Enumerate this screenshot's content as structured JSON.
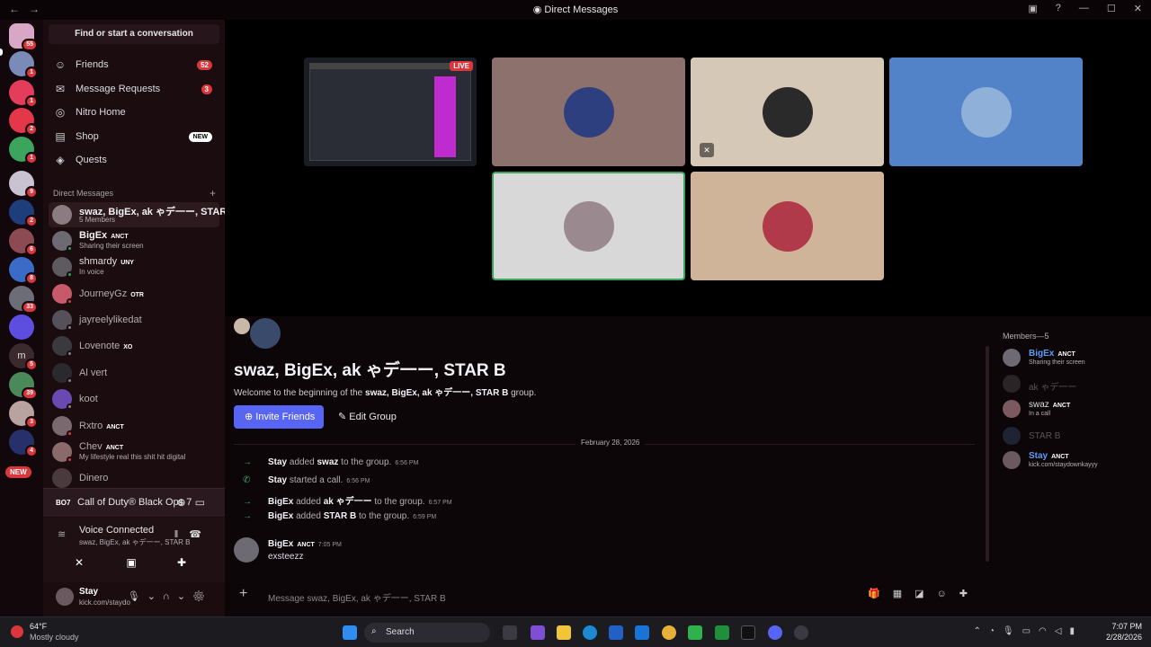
{
  "window": {
    "title": "Direct Messages"
  },
  "servers": [
    {
      "badge": "55"
    },
    {
      "badge": "1"
    },
    {
      "badge": "1"
    },
    {
      "badge": "2"
    },
    {
      "badge": "1"
    },
    {
      "badge": "9"
    },
    {
      "badge": "2"
    },
    {
      "badge": "6"
    },
    {
      "badge": "8"
    },
    {
      "badge": "33"
    },
    {
      "badge": ""
    },
    {
      "badge": "5"
    },
    {
      "badge": "39"
    },
    {
      "badge": "3"
    },
    {
      "badge": "4"
    }
  ],
  "rail_new": "NEW",
  "sidebar": {
    "find_label": "Find or start a conversation",
    "nav": [
      {
        "label": "Friends",
        "count": "52"
      },
      {
        "label": "Message Requests",
        "count": "3"
      },
      {
        "label": "Nitro Home",
        "count": ""
      },
      {
        "label": "Shop",
        "tag": "NEW"
      },
      {
        "label": "Quests",
        "count": ""
      }
    ],
    "dm_header": "Direct Messages",
    "dms": [
      {
        "name": "swaz, BigEx, ak ゃデ一ー, STAR B",
        "sub": "5 Members",
        "active": true,
        "bold": true
      },
      {
        "name": "BigEx",
        "tag": "ANCT",
        "sub": "Sharing their screen",
        "bold": true
      },
      {
        "name": "shmardy",
        "tag": "UNY",
        "sub": "In voice"
      },
      {
        "name": "JourneyGz",
        "tag": "OTR",
        "sub": ""
      },
      {
        "name": "jayreelylikedat",
        "sub": ""
      },
      {
        "name": "Lovenote",
        "tag": "XO",
        "sub": ""
      },
      {
        "name": "Al vert",
        "sub": ""
      },
      {
        "name": "koot",
        "sub": ""
      },
      {
        "name": "Rxtro",
        "tag": "ANCT",
        "sub": ""
      },
      {
        "name": "Chev",
        "tag": "ANCT",
        "sub": "My lifestyle real this shit hit digital"
      },
      {
        "name": "Dinero",
        "sub": ""
      }
    ]
  },
  "activity": {
    "logo": "BO7",
    "game": "Call of Duty® Black Ops 7"
  },
  "voice": {
    "status": "Voice Connected",
    "channel": "swaz, BigEx, ak ゃデ一ー, STAR B"
  },
  "user": {
    "name": "Stay",
    "status": "kick.com/staydo"
  },
  "call": {
    "live_label": "LIVE"
  },
  "chat": {
    "title": "swaz, BigEx, ak ゃデ一ー, STAR B",
    "welcome_prefix": "Welcome to the beginning of the ",
    "welcome_group": "swaz, BigEx, ak ゃデ一ー, STAR B",
    "welcome_suffix": " group.",
    "invite_label": "Invite Friends",
    "edit_label": "Edit Group",
    "date_divider": "February 28, 2026",
    "system": [
      {
        "actor": "Stay",
        "verb": " added ",
        "target": "swaz",
        "rest": " to the group.",
        "time": "6:56 PM",
        "kind": "add"
      },
      {
        "actor": "Stay",
        "verb": " started a call.",
        "target": "",
        "rest": "",
        "time": "6:56 PM",
        "kind": "call"
      },
      {
        "actor": "BigEx",
        "verb": " added ",
        "target": "ak ゃデ一ー",
        "rest": " to the group.",
        "time": "6:57 PM",
        "kind": "add"
      },
      {
        "actor": "BigEx",
        "verb": " added ",
        "target": "STAR B",
        "rest": " to the group.",
        "time": "6:59 PM",
        "kind": "add"
      }
    ],
    "message": {
      "author": "BigEx",
      "tag": "ANCT",
      "time": "7:05 PM",
      "text": "exsteezz"
    },
    "composer_placeholder": "Message swaz, BigEx, ak ゃデ一ー, STAR B"
  },
  "members": {
    "header": "Members—5",
    "list": [
      {
        "name": "BigEx",
        "tag": "ANCT",
        "sub": "Sharing their screen",
        "bold": true
      },
      {
        "name": "ak ゃデ一ー",
        "sub": "",
        "offline": true
      },
      {
        "name": "swaz",
        "tag": "ANCT",
        "sub": "In a call"
      },
      {
        "name": "STAR B",
        "sub": "",
        "offline": true
      },
      {
        "name": "Stay",
        "tag": "ANCT",
        "sub": "kick.com/staydownkayyy",
        "bold": true
      }
    ]
  },
  "taskbar": {
    "temp": "64°F",
    "weather": "Mostly cloudy",
    "search_placeholder": "Search",
    "time": "7:07 PM",
    "date": "2/28/2026"
  },
  "colors": {
    "accent": "#5865f2",
    "danger": "#da373c",
    "online": "#23a55a"
  }
}
